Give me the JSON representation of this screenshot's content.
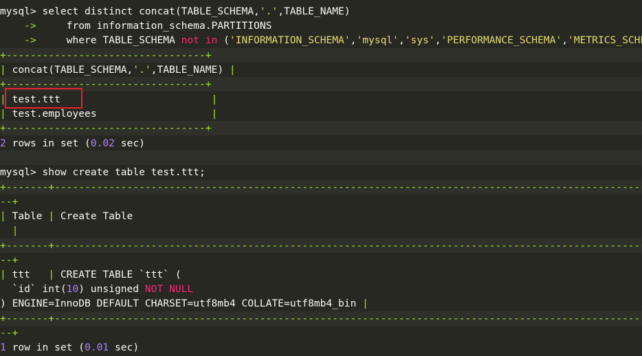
{
  "terminal": {
    "prompt": "mysql",
    "continuation": "->",
    "query1": {
      "line1_cmd": " select distinct concat(TABLE_SCHEMA,",
      "line1_str": "'.'",
      "line1_tail": ",TABLE_NAME)",
      "line2_text": "     from information_schema.PARTITIONS",
      "line3_pre": "     where TABLE_SCHEMA ",
      "line3_kw": "not in",
      "line3_open": " (",
      "line3_s1": "'INFORMATION_SCHEMA'",
      "line3_s2": "'mysql'",
      "line3_s3": "'sys'",
      "line3_s4": "'PERFORMANCE_SCHEMA'",
      "line3_s5": "'METRICS_SCHEMA'",
      "line3_close": ");"
    },
    "table1": {
      "border": "+---------------------------------+",
      "header_pre": " concat(TABLE_SCHEMA,",
      "header_str": "'.'",
      "header_tail": ",TABLE_NAME) ",
      "rows": [
        "test.ttt",
        "test.employees"
      ],
      "cell_pad": "                         ",
      "cell_pad2": "                   "
    },
    "result1": {
      "count": "2",
      "mid": " rows in set (",
      "time": "0.02",
      "tail": " sec)"
    },
    "query2": {
      "cmd": " show create table test.ttt;"
    },
    "table2": {
      "border_top": "+-------+----------------------------------------------------------------------------------------------------------------------------",
      "border_wrap": "--+",
      "header_col1": " Table ",
      "header_col2": " Create Table",
      "border_mid": "+-------+----------------------------------------------------------------------------------------------------------------------------",
      "data_col1": " ttt   ",
      "data_line1": " CREATE TABLE `ttt` (",
      "data_line2_pre": "  `id` int(",
      "data_line2_num": "10",
      "data_line2_mid": ") unsigned ",
      "data_line2_kw": "NOT NULL",
      "data_line3": ") ENGINE=InnoDB DEFAULT CHARSET=utf8mb4 COLLATE=utf8mb4_bin ",
      "border_bottom": "+-------+----------------------------------------------------------------------------------------------------------------------------"
    },
    "result2": {
      "count": "1",
      "mid": " row in set (",
      "time": "0.01",
      "tail": " sec)"
    }
  },
  "colors": {
    "background": "#272822",
    "text": "#f8f8f2",
    "string": "#e6db74",
    "keyword": "#f92672",
    "number": "#ae81ff",
    "border": "#a6e22e",
    "highlight_box": "#e8242b"
  }
}
